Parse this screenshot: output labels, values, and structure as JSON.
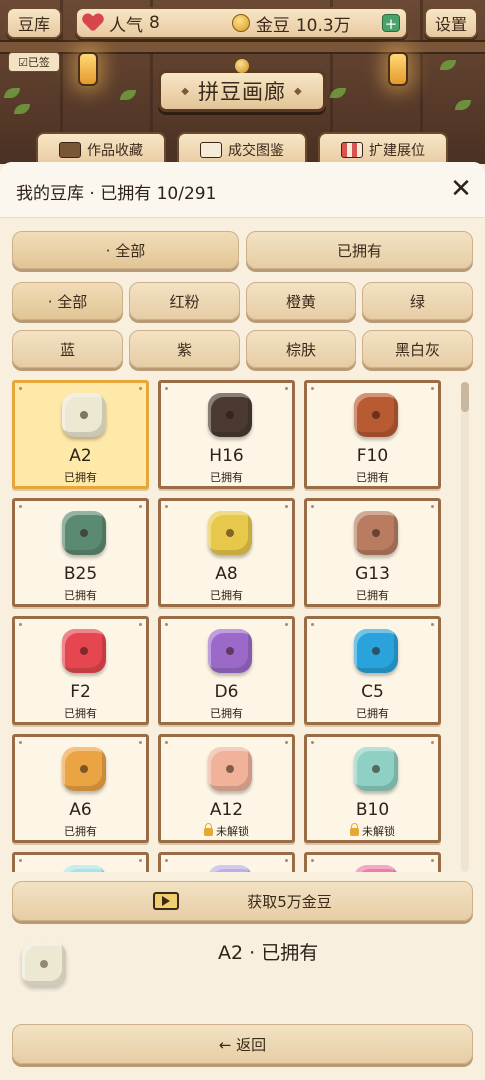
{
  "header": {
    "bank_button": "豆库",
    "popularity_label": "人气",
    "popularity_value": "8",
    "coins_label": "金豆",
    "coins_value": "10.3万",
    "plus_label": "+",
    "settings_button": "设置",
    "signed_badge": "☑已签",
    "gallery_sign": "拼豆画廊",
    "nav": [
      {
        "label": "作品收藏",
        "icon": "book-shelf-icon"
      },
      {
        "label": "成交图鉴",
        "icon": "open-book-icon"
      },
      {
        "label": "扩建展位",
        "icon": "shop-awning-icon"
      }
    ]
  },
  "panel": {
    "title": "我的豆库 · 已拥有 10/291",
    "close": "✕",
    "ownership_filters": [
      "· 全部",
      "已拥有"
    ],
    "color_filters": [
      "· 全部",
      "红粉",
      "橙黄",
      "绿",
      "蓝",
      "紫",
      "棕肤",
      "黑白灰"
    ],
    "beads": [
      {
        "code": "A2",
        "status": "已拥有",
        "color": "#ece8d2",
        "locked": false
      },
      {
        "code": "H16",
        "status": "已拥有",
        "color": "#4a3a31",
        "locked": false
      },
      {
        "code": "F10",
        "status": "已拥有",
        "color": "#b85a32",
        "locked": false
      },
      {
        "code": "B25",
        "status": "已拥有",
        "color": "#5b8a72",
        "locked": false
      },
      {
        "code": "A8",
        "status": "已拥有",
        "color": "#e8c84a",
        "locked": false
      },
      {
        "code": "G13",
        "status": "已拥有",
        "color": "#b97c60",
        "locked": false
      },
      {
        "code": "F2",
        "status": "已拥有",
        "color": "#e6464f",
        "locked": false
      },
      {
        "code": "D6",
        "status": "已拥有",
        "color": "#9b6ac9",
        "locked": false
      },
      {
        "code": "C5",
        "status": "已拥有",
        "color": "#2aa3dc",
        "locked": false
      },
      {
        "code": "A6",
        "status": "已拥有",
        "color": "#eba444",
        "locked": false
      },
      {
        "code": "A12",
        "status": "未解锁",
        "color": "#f0b39a",
        "locked": true
      },
      {
        "code": "B10",
        "status": "未解锁",
        "color": "#8fd0c4",
        "locked": true
      },
      {
        "code": "",
        "status": "",
        "color": "#a8e4e6",
        "locked": false
      },
      {
        "code": "",
        "status": "",
        "color": "#b8b0e6",
        "locked": false
      },
      {
        "code": "",
        "status": "",
        "color": "#f07aa8",
        "locked": false
      }
    ],
    "get_coins_button": "获取5万金豆",
    "selected": {
      "text": "A2 · 已拥有",
      "color": "#ece8d2"
    },
    "back_button": "← 返回"
  }
}
